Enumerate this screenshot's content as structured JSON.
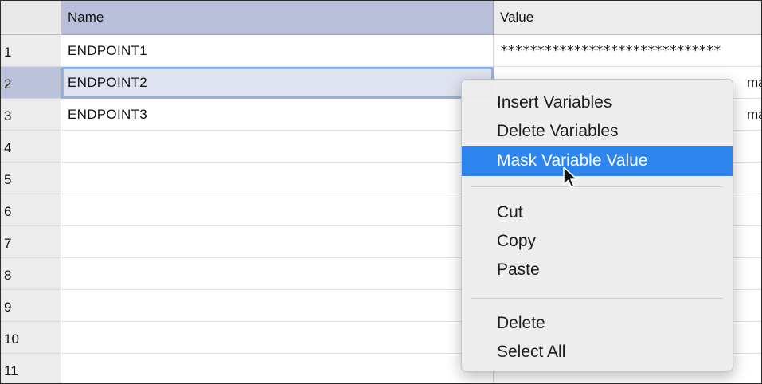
{
  "table": {
    "headers": {
      "name": "Name",
      "value": "Value"
    },
    "rows": [
      {
        "num": "1",
        "name": "ENDPOINT1",
        "value": "******************************"
      },
      {
        "num": "2",
        "name": "ENDPOINT2",
        "value": "mak"
      },
      {
        "num": "3",
        "name": "ENDPOINT3",
        "value": "mak"
      },
      {
        "num": "4",
        "name": "",
        "value": ""
      },
      {
        "num": "5",
        "name": "",
        "value": ""
      },
      {
        "num": "6",
        "name": "",
        "value": ""
      },
      {
        "num": "7",
        "name": "",
        "value": ""
      },
      {
        "num": "8",
        "name": "",
        "value": ""
      },
      {
        "num": "9",
        "name": "",
        "value": ""
      },
      {
        "num": "10",
        "name": "",
        "value": ""
      },
      {
        "num": "11",
        "name": "",
        "value": ""
      }
    ],
    "selected_row": "2"
  },
  "context_menu": {
    "items": [
      {
        "label": "Insert Variables"
      },
      {
        "label": "Delete Variables"
      },
      {
        "label": "Mask Variable Value",
        "highlighted": true
      },
      {
        "label": "Cut"
      },
      {
        "label": "Copy"
      },
      {
        "label": "Paste"
      },
      {
        "label": "Delete"
      },
      {
        "label": "Select All"
      }
    ]
  },
  "colors": {
    "highlight": "#2f85ef",
    "selected_header": "#b9bfd8",
    "selected_cell_border": "#8fb3e9"
  },
  "icons": {
    "cursor": "arrow-pointer-icon"
  }
}
